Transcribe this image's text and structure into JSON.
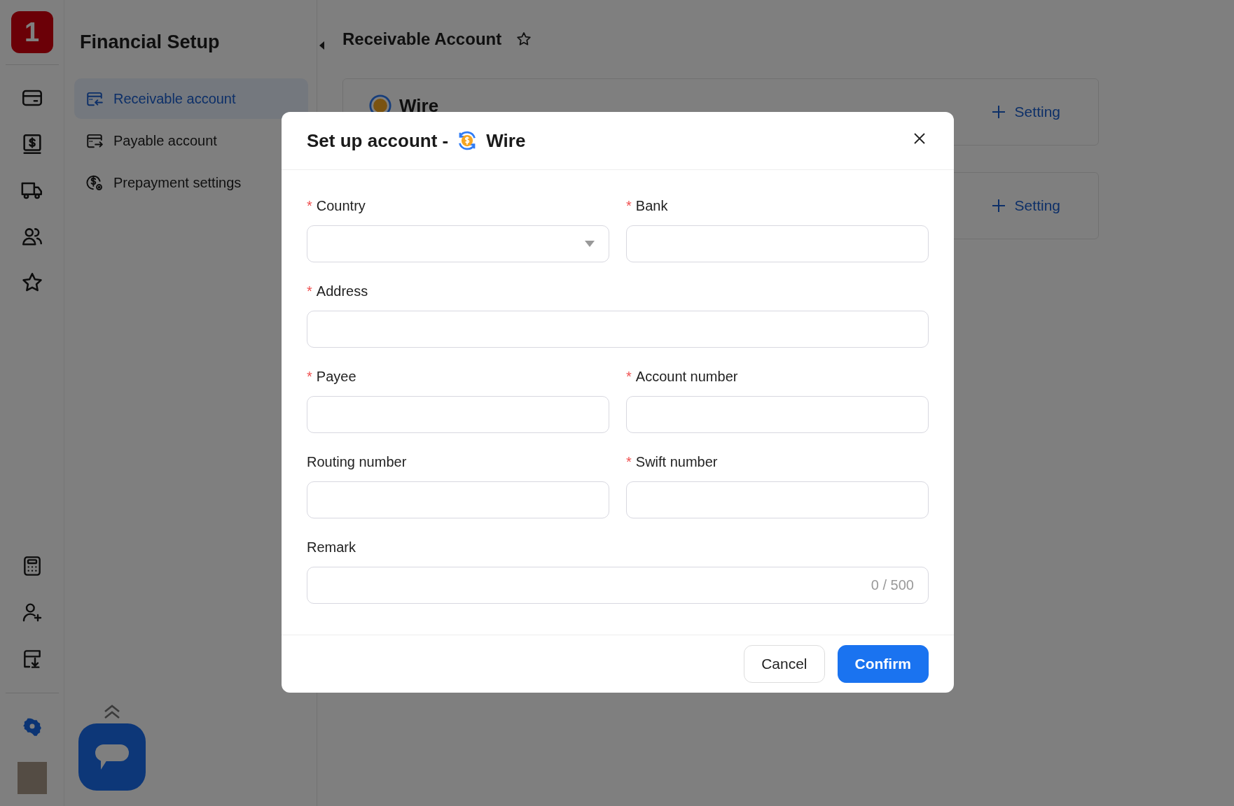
{
  "app_logo": {
    "text": "1"
  },
  "rail": {
    "top_items": [
      {
        "selected": false
      },
      {
        "selected": false
      },
      {
        "selected": false
      },
      {
        "selected": false
      },
      {
        "selected": false
      }
    ],
    "bottom_items": [
      {
        "selected": false
      },
      {
        "selected": false
      },
      {
        "selected": false
      }
    ],
    "settings": {
      "selected": true
    }
  },
  "sidebar": {
    "title": "Financial Setup",
    "items": [
      {
        "label": "Receivable account",
        "selected": true
      },
      {
        "label": "Payable account",
        "selected": false
      },
      {
        "label": "Prepayment settings",
        "selected": false
      }
    ]
  },
  "main": {
    "title": "Receivable Account",
    "cards": [
      {
        "title": "Wire",
        "action": "Setting"
      },
      {
        "action": "Setting"
      }
    ]
  },
  "dialog": {
    "title": "Set up account -",
    "method": "Wire",
    "fields": [
      {
        "label": "Country",
        "required": true,
        "kind": "select"
      },
      {
        "label": "Bank",
        "required": true,
        "kind": "text"
      },
      {
        "label": "Address",
        "required": true,
        "kind": "wide_text"
      },
      {
        "label": "Payee",
        "required": true,
        "kind": "text"
      },
      {
        "label": "Account number",
        "required": true,
        "kind": "text"
      },
      {
        "label": "Routing number",
        "required": false,
        "kind": "text"
      },
      {
        "label": "Swift number",
        "required": true,
        "kind": "text"
      },
      {
        "label": "Remark",
        "required": false,
        "kind": "counted_text",
        "counter": "0 / 500"
      }
    ],
    "required_mark": "*",
    "buttons": [
      {
        "label": "Cancel",
        "kind": "secondary"
      },
      {
        "label": "Confirm",
        "kind": "primary"
      }
    ]
  }
}
